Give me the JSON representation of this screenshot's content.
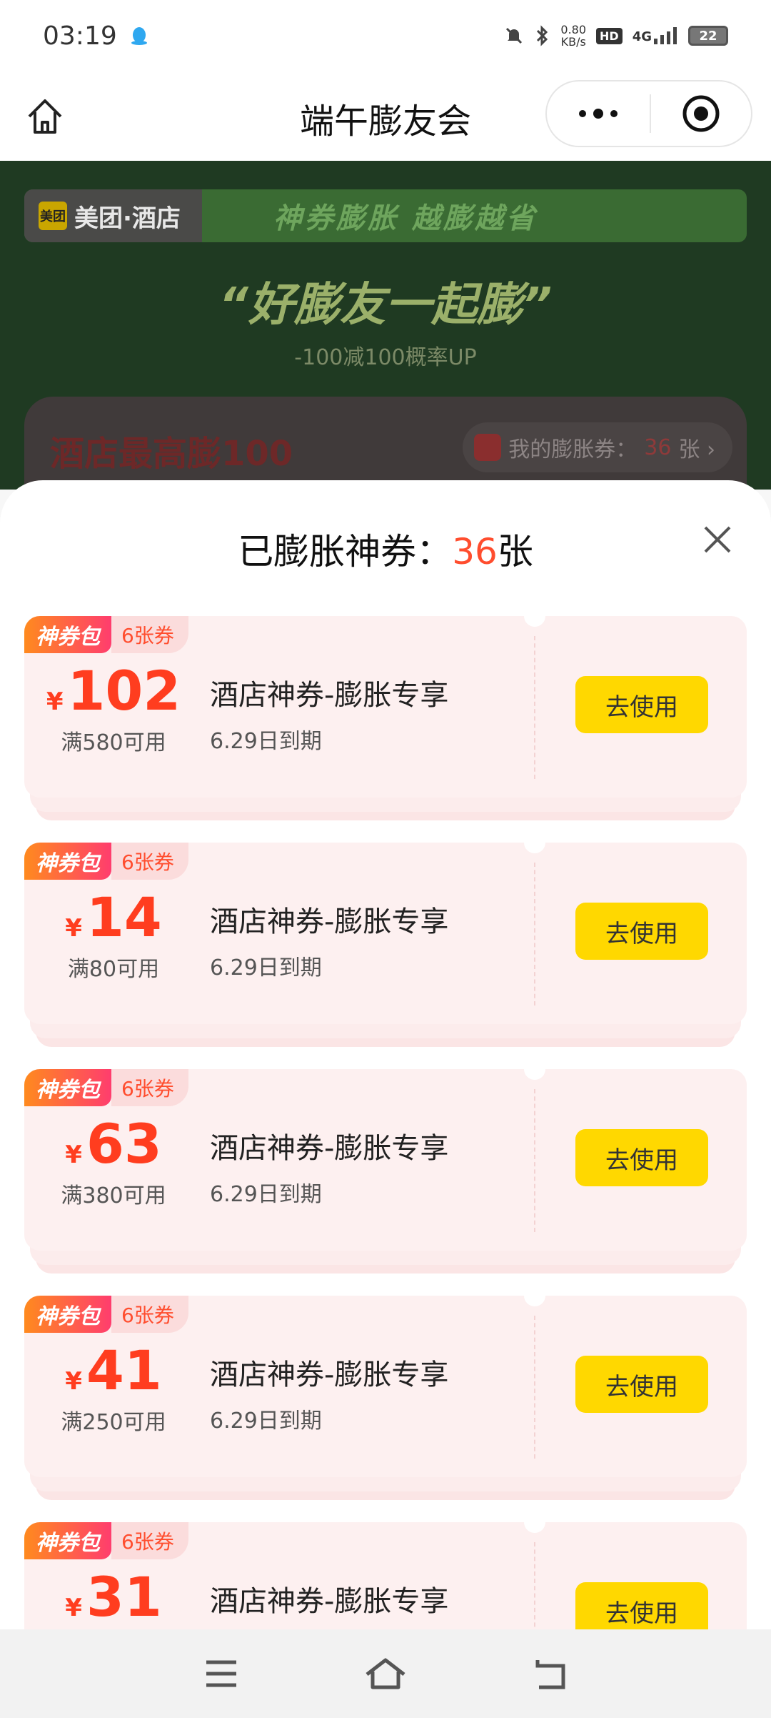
{
  "status_bar": {
    "time": "03:19",
    "net_speed_value": "0.80",
    "net_speed_unit": "KB/s",
    "hd": "HD",
    "network": "4G",
    "battery": "22"
  },
  "title_bar": {
    "title": "端午膨友会"
  },
  "banner": {
    "brand": "美团·酒店",
    "brand_logo": "美团",
    "slogan": "神券膨胀 越膨越省",
    "big_slogan": "“好膨友一起膨”",
    "sub_slogan": "-100减100概率UP",
    "card_title": "酒店最高膨100",
    "my_coupons_label": "我的膨胀券：",
    "my_coupons_count": "36",
    "my_coupons_unit": "张 ›"
  },
  "sheet": {
    "title_prefix": "已膨胀神券：",
    "title_count": "36",
    "title_suffix": "张"
  },
  "coupons": [
    {
      "tag": "神券包",
      "pack_count": "6张券",
      "yen": "¥",
      "amount": "102",
      "condition": "满580可用",
      "name": "酒店神券-膨胀专享",
      "expiry": "6.29日到期",
      "button": "去使用"
    },
    {
      "tag": "神券包",
      "pack_count": "6张券",
      "yen": "¥",
      "amount": "14",
      "condition": "满80可用",
      "name": "酒店神券-膨胀专享",
      "expiry": "6.29日到期",
      "button": "去使用"
    },
    {
      "tag": "神券包",
      "pack_count": "6张券",
      "yen": "¥",
      "amount": "63",
      "condition": "满380可用",
      "name": "酒店神券-膨胀专享",
      "expiry": "6.29日到期",
      "button": "去使用"
    },
    {
      "tag": "神券包",
      "pack_count": "6张券",
      "yen": "¥",
      "amount": "41",
      "condition": "满250可用",
      "name": "酒店神券-膨胀专享",
      "expiry": "6.29日到期",
      "button": "去使用"
    },
    {
      "tag": "神券包",
      "pack_count": "6张券",
      "yen": "¥",
      "amount": "31",
      "condition": "",
      "name": "酒店神券-膨胀专享",
      "expiry": "",
      "button": "去使用"
    }
  ],
  "colors": {
    "accent": "#ff4d2e",
    "button": "#ffd800",
    "coupon_bg": "#fdf0f0"
  }
}
